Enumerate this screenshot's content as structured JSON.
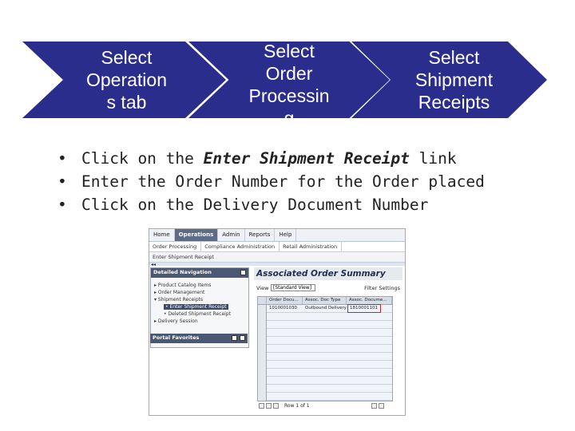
{
  "steps": [
    {
      "label": "Select\nOperation\ns tab"
    },
    {
      "label": "Select\nOrder\nProcessin\ng"
    },
    {
      "label": "Select\nShipment\nReceipts"
    }
  ],
  "bullets": [
    {
      "prefix": "Click on the ",
      "emph": "Enter Shipment Receipt",
      "suffix": " link"
    },
    {
      "text": "Enter the Order Number for the Order placed"
    },
    {
      "text": "Click on the Delivery Document Number"
    }
  ],
  "screenshot": {
    "top_tabs": [
      "Home",
      "Operations",
      "Admin",
      "Reports",
      "Help"
    ],
    "active_tab": "Operations",
    "sub_tabs": [
      "Order Processing",
      "Compliance Administration",
      "Retail Administration"
    ],
    "breadcrumb": "Enter Shipment Receipt",
    "detailed_nav": {
      "title": "Detailed Navigation",
      "items": [
        {
          "label": "▸ Product Catalog Items"
        },
        {
          "label": "▸ Order Management"
        },
        {
          "label": "▾ Shipment Receipts"
        },
        {
          "label": "• Enter Shipment Receipt",
          "indent": true,
          "selected": true
        },
        {
          "label": "• Deleted Shipment Receipt",
          "indent": true
        },
        {
          "label": "▸ Delivery Session"
        }
      ]
    },
    "portal_favorites": "Portal Favorites",
    "summary_title": "Associated Order Summary",
    "view_label": "View",
    "view_value": "[Standard View]",
    "filter_settings": "Filter Settings",
    "columns": [
      "Order Docu...",
      "Assoc. Doc Type",
      "Assoc. Docume..."
    ],
    "row": [
      "1010001030",
      "Outbound Delivery",
      "1810001101"
    ],
    "pager_label": "Row 1 of 1"
  }
}
